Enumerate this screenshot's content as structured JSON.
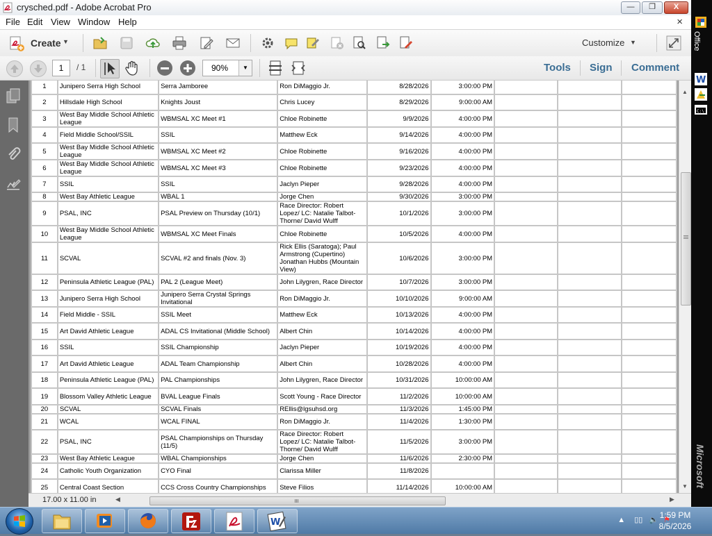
{
  "window": {
    "title": "crysched.pdf - Adobe Acrobat Pro",
    "min_label": "—",
    "max_label": "❐",
    "close_label": "X"
  },
  "menu": {
    "items": [
      "File",
      "Edit",
      "View",
      "Window",
      "Help"
    ],
    "close_glyph": "×"
  },
  "toolbar": {
    "create_label": "Create",
    "customize_label": "Customize",
    "page_current": "1",
    "page_total": "/ 1",
    "zoom": "90%",
    "panes": [
      "Tools",
      "Sign",
      "Comment"
    ]
  },
  "colors": {
    "accent_link": "#3a6d94",
    "acrobat_red": "#c8102e"
  },
  "status": {
    "page_size": "17.00 x 11.00 in"
  },
  "table": {
    "rows": [
      [
        "1",
        "Junipero Serra High School",
        "Serra Jamboree",
        "Ron DiMaggio Jr.",
        "8/28/2026",
        "3:00:00 PM"
      ],
      [
        "2",
        "Hillsdale High School",
        "Knights Joust",
        "Chris Lucey",
        "8/29/2026",
        "9:00:00 AM"
      ],
      [
        "3",
        "West Bay Middle School Athletic League",
        "WBMSAL XC Meet #1",
        "Chloe Robinette",
        "9/9/2026",
        "4:00:00 PM"
      ],
      [
        "4",
        "Field Middle School/SSIL",
        "SSIL",
        "Matthew Eck",
        "9/14/2026",
        "4:00:00 PM"
      ],
      [
        "5",
        "West Bay Middle School Athletic League",
        "WBMSAL XC Meet #2",
        "Chloe Robinette",
        "9/16/2026",
        "4:00:00 PM"
      ],
      [
        "6",
        "West Bay Middle School Athletic League",
        "WBMSAL XC Meet #3",
        "Chloe Robinette",
        "9/23/2026",
        "4:00:00 PM"
      ],
      [
        "7",
        "SSIL",
        "SSIL",
        "Jaclyn Pieper",
        "9/28/2026",
        "4:00:00 PM"
      ],
      [
        "8",
        "West Bay Athletic League",
        "WBAL 1",
        "Jorge Chen",
        "9/30/2026",
        "3:00:00 PM"
      ],
      [
        "9",
        "PSAL, INC",
        "PSAL Preview on Thursday (10/1)",
        "Race Director: Robert Lopez/ LC: Natalie Talbot-Thorne/ David Wulff",
        "10/1/2026",
        "3:00:00 PM"
      ],
      [
        "10",
        "West Bay Middle School Athletic League",
        "WBMSAL XC Meet Finals",
        "Chloe Robinette",
        "10/5/2026",
        "4:00:00 PM"
      ],
      [
        "11",
        "SCVAL",
        "SCVAL #2 and finals (Nov. 3)",
        "Rick Ellis (Saratoga); Paul Armstrong (Cupertino) Jonathan Hubbs (Mountain View)",
        "10/6/2026",
        "3:00:00 PM"
      ],
      [
        "12",
        "Peninsula Athletic League (PAL)",
        "PAL 2 (League Meet)",
        "John Lilygren, Race Director",
        "10/7/2026",
        "3:00:00 PM"
      ],
      [
        "13",
        "Junipero Serra High School",
        "Junipero Serra Crystal Springs Invitational",
        "Ron DiMaggio Jr.",
        "10/10/2026",
        "9:00:00 AM"
      ],
      [
        "14",
        "Field Middle - SSIL",
        "SSIL Meet",
        "Matthew Eck",
        "10/13/2026",
        "4:00:00 PM"
      ],
      [
        "15",
        "Art David Athletic League",
        "ADAL CS Invitational (Middle School)",
        "Albert Chin",
        "10/14/2026",
        "4:00:00 PM"
      ],
      [
        "16",
        "SSIL",
        "SSIL Championship",
        "Jaclyn Pieper",
        "10/19/2026",
        "4:00:00 PM"
      ],
      [
        "17",
        "Art David Athletic League",
        "ADAL Team Championship",
        "Albert Chin",
        "10/28/2026",
        "4:00:00 PM"
      ],
      [
        "18",
        "Peninsula Athletic League (PAL)",
        "PAL Championships",
        "John Lilygren, Race Director",
        "10/31/2026",
        "10:00:00 AM"
      ],
      [
        "19",
        "Blossom Valley Athletic League",
        "BVAL League Finals",
        "Scott Young - Race Director",
        "11/2/2026",
        "10:00:00 AM"
      ],
      [
        "20",
        "SCVAL",
        "SCVAL Finals",
        "REllis@lgsuhsd.org",
        "11/3/2026",
        "1:45:00 PM"
      ],
      [
        "21",
        "WCAL",
        "WCAL FINAL",
        "Ron DiMaggio Jr.",
        "11/4/2026",
        "1:30:00 PM"
      ],
      [
        "22",
        "PSAL, INC",
        "PSAL Championships on Thursday (11/5)",
        "Race Director: Robert Lopez/ LC: Natalie Talbot-Thorne/ David Wulff",
        "11/5/2026",
        "3:00:00 PM"
      ],
      [
        "23",
        "West Bay Athletic League",
        "WBAL Championships",
        "Jorge Chen",
        "11/6/2026",
        "2:30:00 PM"
      ],
      [
        "24",
        "Catholic Youth Organization",
        "CYO Final",
        "Clarissa Miller",
        "11/8/2026",
        ""
      ],
      [
        "25",
        "Central Coast Section",
        "CCS Cross Country Championships",
        "Steve Filios",
        "11/14/2026",
        "10:00:00 AM"
      ]
    ]
  },
  "officebar": {
    "label": "Office",
    "brand": "Microsoft"
  },
  "taskbar": {
    "time": "1:59 PM",
    "date": "8/5/2026"
  }
}
